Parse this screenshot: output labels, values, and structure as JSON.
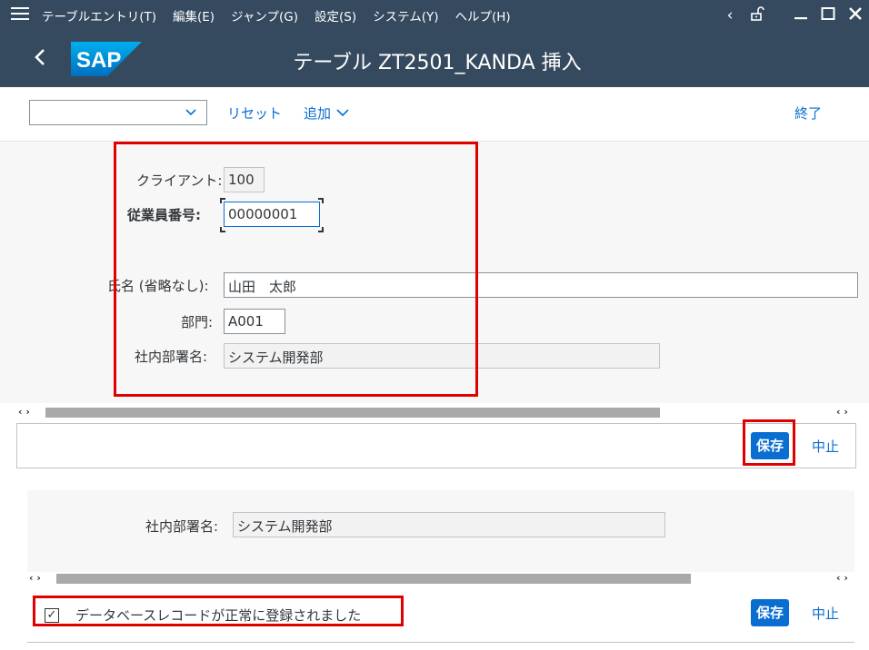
{
  "menu": {
    "items": [
      "テーブルエントリ(T)",
      "編集(E)",
      "ジャンプ(G)",
      "設定(S)",
      "システム(Y)",
      "ヘルプ(H)"
    ]
  },
  "window_controls": {
    "back": "‹",
    "lock": "🔓",
    "minimize": "_",
    "maximize": "☐",
    "close": "×"
  },
  "title": "テーブル ZT2501_KANDA 挿入",
  "logo_text": "SAP",
  "toolbar": {
    "dropdown_value": "",
    "reset": "リセット",
    "add": "追加",
    "exit": "終了"
  },
  "form": {
    "client_label": "クライアント:",
    "client_value": "100",
    "employee_no_label": "従業員番号:",
    "employee_no_value": "00000001",
    "name_label": "氏名 (省略なし):",
    "name_value": "山田　太郎",
    "dept_label": "部門:",
    "dept_value": "A001",
    "dept_name_label": "社内部署名:",
    "dept_name_value": "システム開発部"
  },
  "footer1": {
    "save": "保存",
    "cancel": "中止"
  },
  "area2": {
    "dept_name_label": "社内部署名:",
    "dept_name_value": "システム開発部"
  },
  "footer2": {
    "message": "データベースレコードが正常に登録されました",
    "save": "保存",
    "cancel": "中止"
  },
  "colors": {
    "shell": "#354a5f",
    "accent": "#0a6ed1",
    "highlight": "#e00000"
  }
}
